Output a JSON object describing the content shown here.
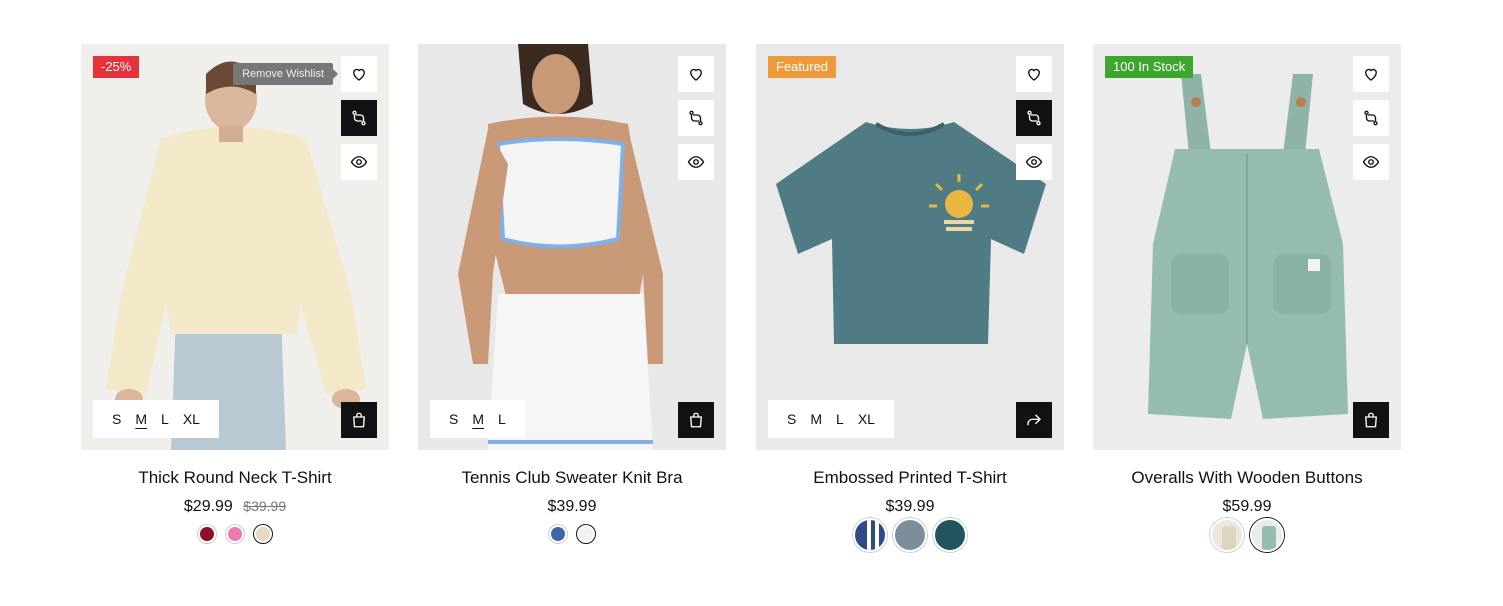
{
  "colors": {
    "badge_sale": "#e5323b",
    "badge_featured": "#ef9a3a",
    "badge_stock": "#3da72d",
    "dark_button": "#111111"
  },
  "products": [
    {
      "name": "Thick Round Neck T-Shirt",
      "price": "$29.99",
      "old_price": "$39.99",
      "badge": "-25%",
      "tooltip": "Remove Wishlist",
      "sizes": [
        "S",
        "M",
        "L",
        "XL"
      ],
      "active_size": "M",
      "swatches": [
        "#8b1128",
        "#ea7bb0",
        "#e6dac7"
      ],
      "selected_swatch": 2,
      "action_icons": [
        "heart-icon",
        "compare-icon",
        "eye-icon"
      ],
      "cart_icon": "bag-icon"
    },
    {
      "name": "Tennis Club Sweater Knit Bra",
      "price": "$39.99",
      "sizes": [
        "S",
        "M",
        "L"
      ],
      "active_size": "M",
      "swatches": [
        "#3f66a8",
        "#f2f2f2"
      ],
      "selected_swatch": 1,
      "action_icons": [
        "heart-icon",
        "compare-icon",
        "eye-icon"
      ],
      "cart_icon": "bag-icon"
    },
    {
      "name": "Embossed Printed T-Shirt",
      "price": "$39.99",
      "badge": "Featured",
      "sizes": [
        "S",
        "M",
        "L",
        "XL"
      ],
      "swatch_images": [
        "navy-white-stripe",
        "grey-blue",
        "dark-teal"
      ],
      "action_icons": [
        "heart-icon",
        "compare-icon",
        "eye-icon"
      ],
      "cart_icon": "share-icon"
    },
    {
      "name": "Overalls With Wooden Buttons",
      "price": "$59.99",
      "badge": "100 In Stock",
      "swatch_images": [
        "beige-overall",
        "sage-overall"
      ],
      "selected_swatch": 1,
      "action_icons": [
        "heart-icon",
        "compare-icon",
        "eye-icon"
      ],
      "cart_icon": "bag-icon"
    }
  ]
}
